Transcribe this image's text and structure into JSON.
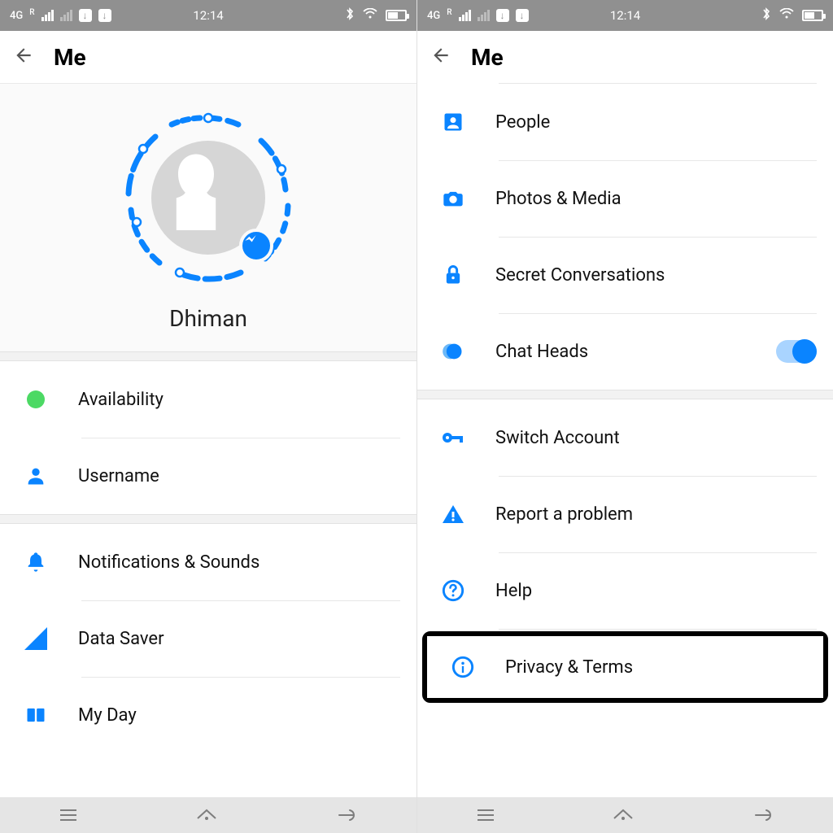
{
  "status": {
    "network": "4G",
    "roaming": "R",
    "time": "12:14"
  },
  "header": {
    "title": "Me"
  },
  "profile": {
    "name": "Dhiman"
  },
  "left": {
    "items": {
      "availability": "Availability",
      "username": "Username",
      "notifications": "Notifications & Sounds",
      "data_saver": "Data Saver",
      "my_day": "My Day"
    }
  },
  "right": {
    "items": {
      "people": "People",
      "photos": "Photos & Media",
      "secret": "Secret Conversations",
      "chat_heads": "Chat Heads",
      "switch": "Switch Account",
      "report": "Report a problem",
      "help": "Help",
      "privacy": "Privacy & Terms"
    }
  }
}
